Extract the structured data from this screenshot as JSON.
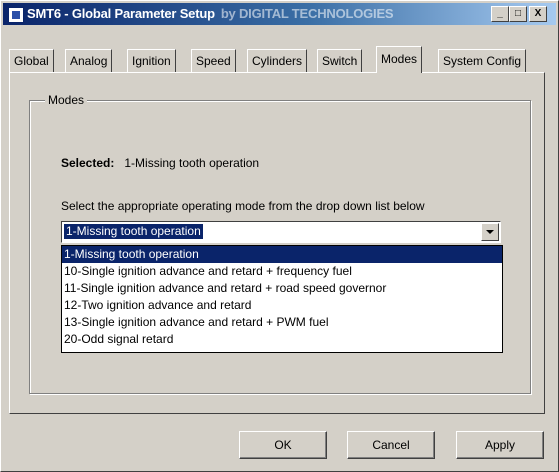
{
  "window": {
    "title": "SMT6 - Global Parameter Setup",
    "brand": "by DIGITAL TECHNOLOGIES",
    "minimize_label": "_",
    "maximize_label": "□",
    "close_label": "X"
  },
  "tabs": [
    {
      "label": "Global"
    },
    {
      "label": "Analog"
    },
    {
      "label": "Ignition"
    },
    {
      "label": "Speed"
    },
    {
      "label": "Cylinders"
    },
    {
      "label": "Switch"
    },
    {
      "label": "Modes"
    },
    {
      "label": "System Config"
    }
  ],
  "active_tab": "Modes",
  "modes": {
    "group_title": "Modes",
    "selected_label": "Selected:",
    "selected_value": "1-Missing tooth operation",
    "instruction": "Select the appropriate operating mode from the drop down list below",
    "combo_value": "1-Missing tooth operation",
    "options": [
      "1-Missing tooth operation",
      "10-Single ignition advance and retard + frequency fuel",
      "11-Single ignition advance and retard + road speed governor",
      "12-Two ignition advance and retard",
      "13-Single ignition advance and retard + PWM fuel",
      "20-Odd signal retard"
    ]
  },
  "buttons": {
    "ok": "OK",
    "cancel": "Cancel",
    "apply": "Apply"
  }
}
